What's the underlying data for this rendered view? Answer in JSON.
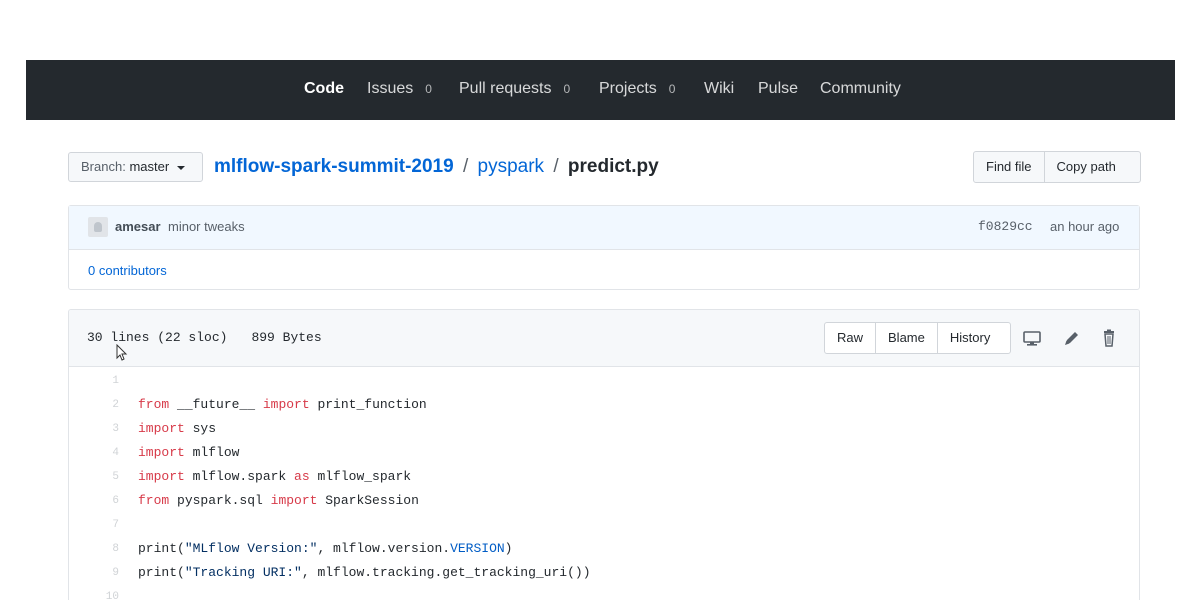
{
  "nav": {
    "items": [
      {
        "label": "Code",
        "count": null
      },
      {
        "label": "Issues",
        "count": "0"
      },
      {
        "label": "Pull requests",
        "count": "0"
      },
      {
        "label": "Projects",
        "count": "0"
      },
      {
        "label": "Wiki",
        "count": null
      },
      {
        "label": "Pulse",
        "count": null
      },
      {
        "label": "Community",
        "count": null
      }
    ],
    "selected": "Code"
  },
  "branch": {
    "prefix": "Branch:",
    "name": "master"
  },
  "breadcrumb": {
    "repo": "mlflow-spark-summit-2019",
    "sep": "/",
    "dir": "pyspark",
    "file": "predict.py"
  },
  "file_actions": {
    "find_file": "Find file",
    "copy_path": "Copy path"
  },
  "commit": {
    "author": "amesar",
    "message": "minor tweaks",
    "sha": "f0829cc",
    "age": "an hour ago",
    "contributors": "0 contributors"
  },
  "file": {
    "lines": "30 lines (22 sloc)",
    "size": "899 Bytes",
    "raw": "Raw",
    "blame": "Blame",
    "history": "History",
    "icons": [
      "desktop-icon",
      "pencil-icon",
      "trash-icon"
    ]
  },
  "code": [
    {
      "num": "1",
      "parts": []
    },
    {
      "num": "2",
      "parts": [
        {
          "t": "from",
          "c": "kw"
        },
        {
          "t": " __future__ ",
          "c": ""
        },
        {
          "t": "import",
          "c": "kw"
        },
        {
          "t": " print_function",
          "c": ""
        }
      ]
    },
    {
      "num": "3",
      "parts": [
        {
          "t": "import",
          "c": "kw"
        },
        {
          "t": " sys",
          "c": ""
        }
      ]
    },
    {
      "num": "4",
      "parts": [
        {
          "t": "import",
          "c": "kw"
        },
        {
          "t": " mlflow",
          "c": ""
        }
      ]
    },
    {
      "num": "5",
      "parts": [
        {
          "t": "import",
          "c": "kw"
        },
        {
          "t": " mlflow.spark ",
          "c": ""
        },
        {
          "t": "as",
          "c": "kw"
        },
        {
          "t": " mlflow_spark",
          "c": ""
        }
      ]
    },
    {
      "num": "6",
      "parts": [
        {
          "t": "from",
          "c": "kw"
        },
        {
          "t": " pyspark.sql ",
          "c": ""
        },
        {
          "t": "import",
          "c": "kw"
        },
        {
          "t": " SparkSession",
          "c": ""
        }
      ]
    },
    {
      "num": "7",
      "parts": []
    },
    {
      "num": "8",
      "parts": [
        {
          "t": "print(",
          "c": ""
        },
        {
          "t": "\"MLflow Version:\"",
          "c": "str"
        },
        {
          "t": ", mlflow.version.",
          "c": ""
        },
        {
          "t": "VERSION",
          "c": "const"
        },
        {
          "t": ")",
          "c": ""
        }
      ]
    },
    {
      "num": "9",
      "parts": [
        {
          "t": "print(",
          "c": ""
        },
        {
          "t": "\"Tracking URI:\"",
          "c": "str"
        },
        {
          "t": ", mlflow.tracking.get_tracking_uri())",
          "c": ""
        }
      ]
    },
    {
      "num": "10",
      "parts": []
    }
  ],
  "colors": {
    "nav_bg": "#24292e",
    "link": "#0366d6",
    "keyword": "#d73a49",
    "string": "#032f62",
    "constant": "#005cc5"
  }
}
